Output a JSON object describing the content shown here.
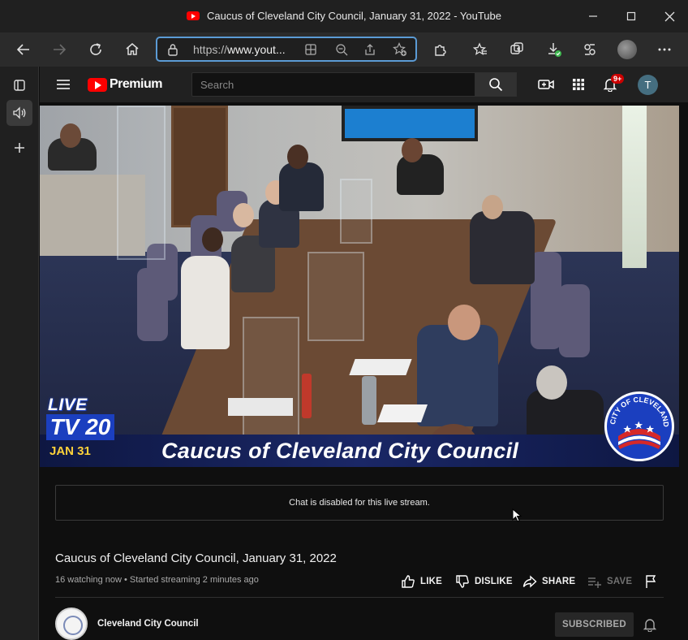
{
  "window": {
    "title": "Caucus of Cleveland City Council, January 31, 2022 - YouTube"
  },
  "browser": {
    "url_prefix": "https://",
    "url_host": "www.yout...",
    "accent": "#5b9bd5"
  },
  "youtube": {
    "logo_text": "Premium",
    "search_placeholder": "Search",
    "notification_count": "9+",
    "user_initial": "T"
  },
  "player": {
    "overlay_live": "LIVE",
    "overlay_channel": "TV 20",
    "overlay_date": "JAN 31",
    "lower_third_title": "Caucus of Cleveland City Council",
    "seal_text": "CITY OF CLEVELAND OHIO"
  },
  "chat": {
    "disabled_message": "Chat is disabled for this live stream."
  },
  "video": {
    "title": "Caucus of Cleveland City Council, January 31, 2022",
    "meta": "16 watching now • Started streaming 2 minutes ago",
    "actions": {
      "like": "LIKE",
      "dislike": "DISLIKE",
      "share": "SHARE",
      "save": "SAVE"
    }
  },
  "channel": {
    "name": "Cleveland City Council",
    "subscribe_label": "SUBSCRIBED"
  },
  "colors": {
    "youtube_red": "#ff0000",
    "background": "#0f0f0f",
    "badge_red": "#cc0000"
  }
}
